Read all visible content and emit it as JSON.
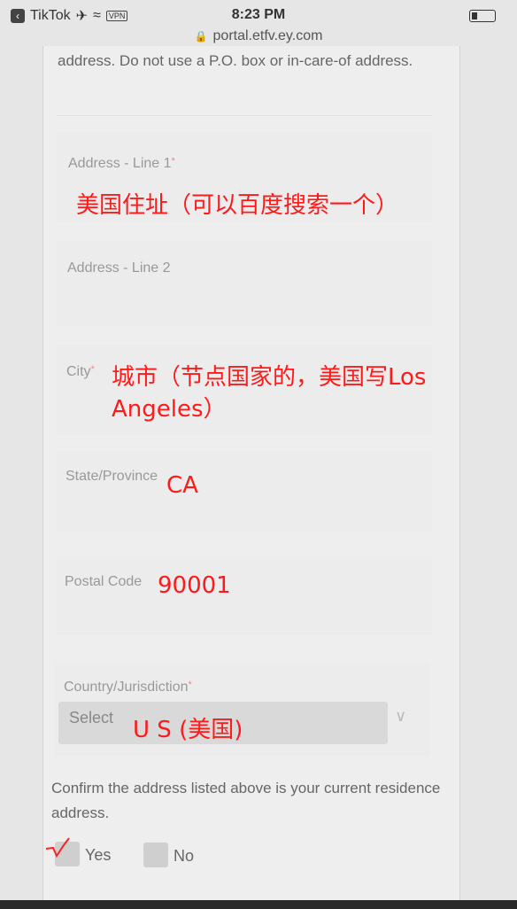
{
  "status": {
    "app_back": "TikTok",
    "time": "8:23 PM",
    "vpn": "VPN"
  },
  "url": "portal.etfv.ey.com",
  "intro_text": "address. Do not use a P.O. box or in-care-of address.",
  "fields": {
    "address1": {
      "label": "Address - Line 1",
      "required": "*",
      "note": "美国住址（可以百度搜索一个）"
    },
    "address2": {
      "label": "Address - Line 2"
    },
    "city": {
      "label": "City",
      "required": "*",
      "note_line1": "城市（节点国家的，美国写Los",
      "note_line2": "Angeles）"
    },
    "state": {
      "label": "State/Province",
      "note": "CA"
    },
    "postal": {
      "label": "Postal Code",
      "note": "90001"
    },
    "country": {
      "label": "Country/Jurisdiction",
      "required": "*",
      "select_value": "Select",
      "note": "U S (美国)"
    }
  },
  "confirm_text": "Confirm the address listed above is your current residence address.",
  "options": {
    "yes": "Yes",
    "no": "No"
  }
}
